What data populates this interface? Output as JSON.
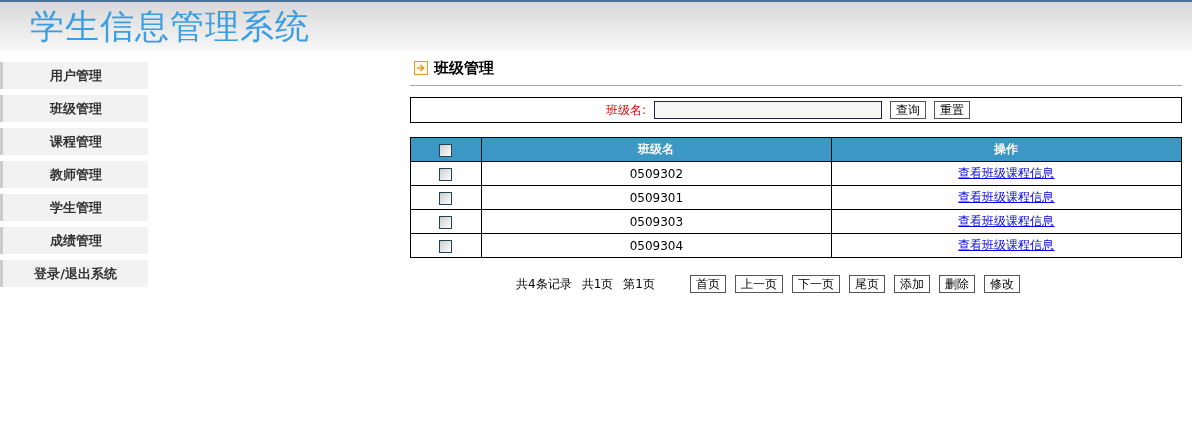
{
  "header": {
    "title": "学生信息管理系统"
  },
  "sidebar": {
    "items": [
      {
        "label": "用户管理"
      },
      {
        "label": "班级管理"
      },
      {
        "label": "课程管理"
      },
      {
        "label": "教师管理"
      },
      {
        "label": "学生管理"
      },
      {
        "label": "成绩管理"
      },
      {
        "label": "登录/退出系统"
      }
    ]
  },
  "page_title": "班级管理",
  "search": {
    "label": "班级名:",
    "buttons": [
      "查询",
      "重置"
    ]
  },
  "table": {
    "select_all": {
      "checked": false
    },
    "columns": [
      "班级名",
      "操作"
    ],
    "rows": [
      {
        "checked": false,
        "name": "0509302",
        "action": "查看班级课程信息"
      },
      {
        "checked": false,
        "name": "0509301",
        "action": "查看班级课程信息"
      },
      {
        "checked": false,
        "name": "0509303",
        "action": "查看班级课程信息"
      },
      {
        "checked": false,
        "name": "0509304",
        "action": "查看班级课程信息"
      }
    ]
  },
  "pagination": {
    "summary": [
      "共4条记录",
      "共1页",
      "第1页"
    ],
    "buttons": [
      "首页",
      "上一页",
      "下一页",
      "尾页",
      "添加",
      "删除",
      "修改"
    ]
  }
}
